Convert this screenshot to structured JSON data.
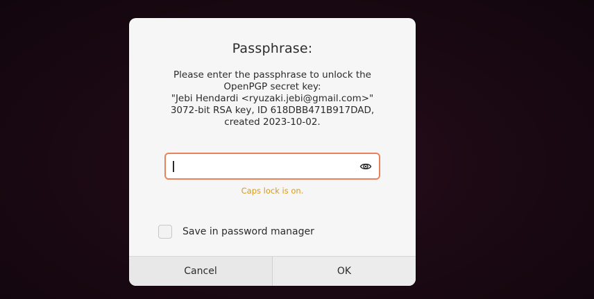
{
  "dialog": {
    "title": "Passphrase:",
    "message_lines": [
      "Please enter the passphrase to unlock the",
      "OpenPGP secret key:",
      "\"Jebi Hendardi <ryuzaki.jebi@gmail.com>\"",
      "3072-bit RSA key, ID 618DBB471B917DAD,",
      "created 2023-10-02."
    ],
    "passphrase": {
      "value": "",
      "placeholder": "",
      "reveal_icon": "eye-icon"
    },
    "warning": "Caps lock is on.",
    "save_password": {
      "label": "Save in password manager",
      "checked": false
    },
    "buttons": {
      "cancel": "Cancel",
      "ok": "OK"
    }
  },
  "colors": {
    "entry_border_focus": "#e9825a",
    "warning": "#d69a1b",
    "dialog_bg": "#f6f6f6"
  }
}
